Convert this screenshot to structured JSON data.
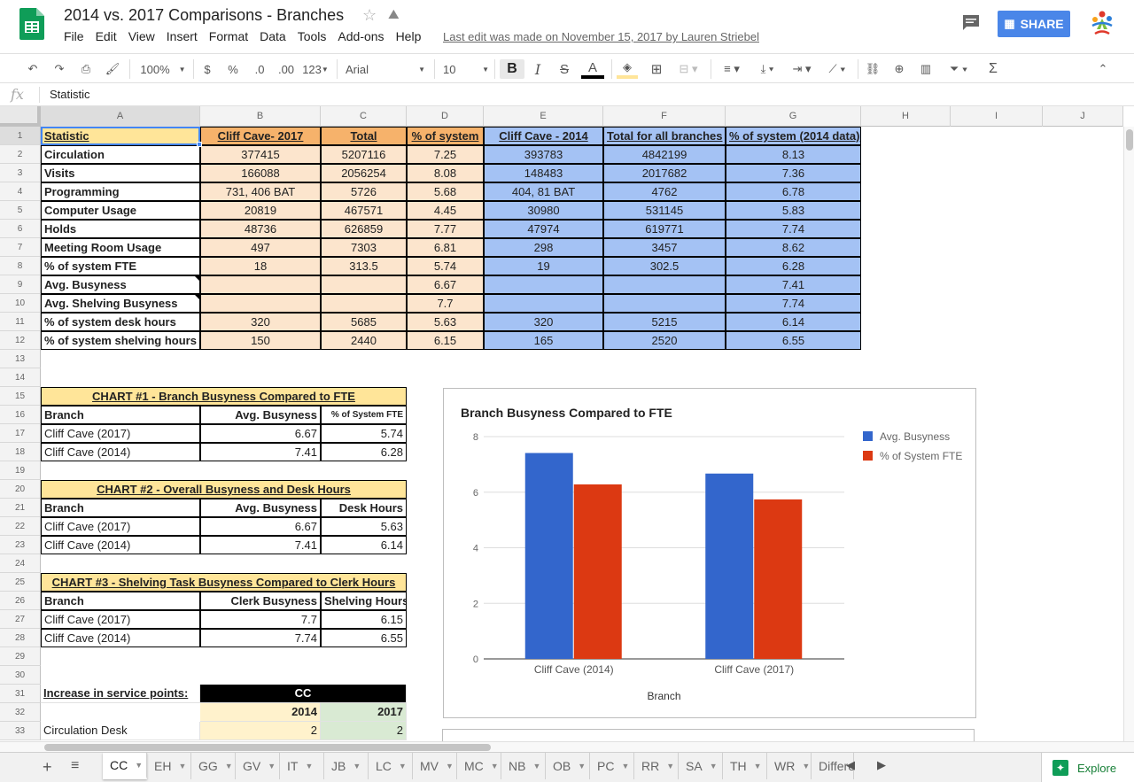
{
  "header": {
    "title": "2014 vs. 2017 Comparisons - Branches",
    "menu": [
      "File",
      "Edit",
      "View",
      "Insert",
      "Format",
      "Data",
      "Tools",
      "Add-ons",
      "Help"
    ],
    "last_edit": "Last edit was made on November 15, 2017 by Lauren Striebel",
    "share_label": "SHARE"
  },
  "toolbar": {
    "zoom": "100%",
    "currency": "$",
    "percent": "%",
    "dec_less": ".0",
    "dec_more": ".00",
    "more_formats": "123",
    "font": "Arial",
    "font_size": "10",
    "bold": "B",
    "italic": "I",
    "strike": "S",
    "text_color": "A",
    "sigma": "Σ"
  },
  "formula_bar": {
    "fx": "fx",
    "value": "Statistic"
  },
  "columns": [
    "A",
    "B",
    "C",
    "D",
    "E",
    "F",
    "G",
    "H",
    "I",
    "J"
  ],
  "row_numbers": [
    "1",
    "2",
    "3",
    "4",
    "5",
    "6",
    "7",
    "8",
    "9",
    "10",
    "11",
    "12",
    "13",
    "14",
    "15",
    "16",
    "17",
    "18",
    "19",
    "20",
    "21",
    "22",
    "23",
    "24",
    "25",
    "26",
    "27",
    "28",
    "29",
    "30",
    "31",
    "32",
    "33"
  ],
  "table1": {
    "headers": [
      "Statistic",
      "Cliff Cave- 2017",
      "Total",
      "% of system",
      "Cliff Cave - 2014",
      "Total for all branches",
      "% of system (2014 data)"
    ],
    "rows": [
      [
        "Circulation",
        "377415",
        "5207116",
        "7.25",
        "393783",
        "4842199",
        "8.13"
      ],
      [
        "Visits",
        "166088",
        "2056254",
        "8.08",
        "148483",
        "2017682",
        "7.36"
      ],
      [
        "Programming",
        "731, 406 BAT",
        "5726",
        "5.68",
        "404, 81 BAT",
        "4762",
        "6.78"
      ],
      [
        "Computer Usage",
        "20819",
        "467571",
        "4.45",
        "30980",
        "531145",
        "5.83"
      ],
      [
        "Holds",
        "48736",
        "626859",
        "7.77",
        "47974",
        "619771",
        "7.74"
      ],
      [
        "Meeting Room Usage",
        "497",
        "7303",
        "6.81",
        "298",
        "3457",
        "8.62"
      ],
      [
        "% of system FTE",
        "18",
        "313.5",
        "5.74",
        "19",
        "302.5",
        "6.28"
      ],
      [
        "Avg. Busyness",
        "",
        "",
        "6.67",
        "",
        "",
        "7.41"
      ],
      [
        "Avg. Shelving Busyness",
        "",
        "",
        "7.7",
        "",
        "",
        "7.74"
      ],
      [
        "% of system desk hours",
        "320",
        "5685",
        "5.63",
        "320",
        "5215",
        "6.14"
      ],
      [
        "% of system shelving hours",
        "150",
        "2440",
        "6.15",
        "165",
        "2520",
        "6.55"
      ]
    ]
  },
  "chart1_table": {
    "title": "CHART #1 - Branch Busyness Compared to FTE",
    "headers": [
      "Branch",
      "Avg. Busyness",
      "% of System FTE"
    ],
    "rows": [
      [
        "Cliff Cave (2017)",
        "6.67",
        "5.74"
      ],
      [
        "Cliff Cave (2014)",
        "7.41",
        "6.28"
      ]
    ]
  },
  "chart2_table": {
    "title": "CHART #2 - Overall Busyness and Desk Hours",
    "headers": [
      "Branch",
      "Avg. Busyness",
      "Desk Hours"
    ],
    "rows": [
      [
        "Cliff Cave (2017)",
        "6.67",
        "5.63"
      ],
      [
        "Cliff Cave (2014)",
        "7.41",
        "6.14"
      ]
    ]
  },
  "chart3_table": {
    "title": "CHART #3 - Shelving Task Busyness Compared to Clerk Hours",
    "headers": [
      "Branch",
      "Clerk Busyness",
      "Shelving Hours"
    ],
    "rows": [
      [
        "Cliff Cave (2017)",
        "7.7",
        "6.15"
      ],
      [
        "Cliff Cave (2014)",
        "7.74",
        "6.55"
      ]
    ]
  },
  "service_points": {
    "label": "Increase in service points:",
    "group": "CC",
    "years": [
      "2014",
      "2017"
    ],
    "rows": [
      [
        "Circulation Desk",
        "2",
        "2"
      ]
    ]
  },
  "chart_data": {
    "type": "bar",
    "title": "Branch Busyness Compared to FTE",
    "xlabel": "Branch",
    "ylabel": "",
    "categories": [
      "Cliff Cave (2014)",
      "Cliff Cave (2017)"
    ],
    "series": [
      {
        "name": "Avg. Busyness",
        "values": [
          7.41,
          6.67
        ],
        "color": "#3366cc"
      },
      {
        "name": "% of System FTE",
        "values": [
          6.28,
          5.74
        ],
        "color": "#dc3912"
      }
    ],
    "yticks": [
      "0",
      "2",
      "4",
      "6",
      "8"
    ],
    "ylim": [
      0,
      8
    ],
    "grid": true,
    "legend": "right"
  },
  "tabs": [
    "CC",
    "EH",
    "GG",
    "GV",
    "IT",
    "JB",
    "LC",
    "MV",
    "MC",
    "NB",
    "OB",
    "PC",
    "RR",
    "SA",
    "TH",
    "WR",
    "Differe"
  ],
  "explore_label": "Explore",
  "colors": {
    "header_orange": "#f6b26b",
    "light_orange": "#fce5cd",
    "blue": "#a4c2f4",
    "yellow": "#ffe599",
    "light_yellow": "#fff2cc",
    "light_green": "#d9ead3",
    "share_blue": "#4a86e8"
  }
}
